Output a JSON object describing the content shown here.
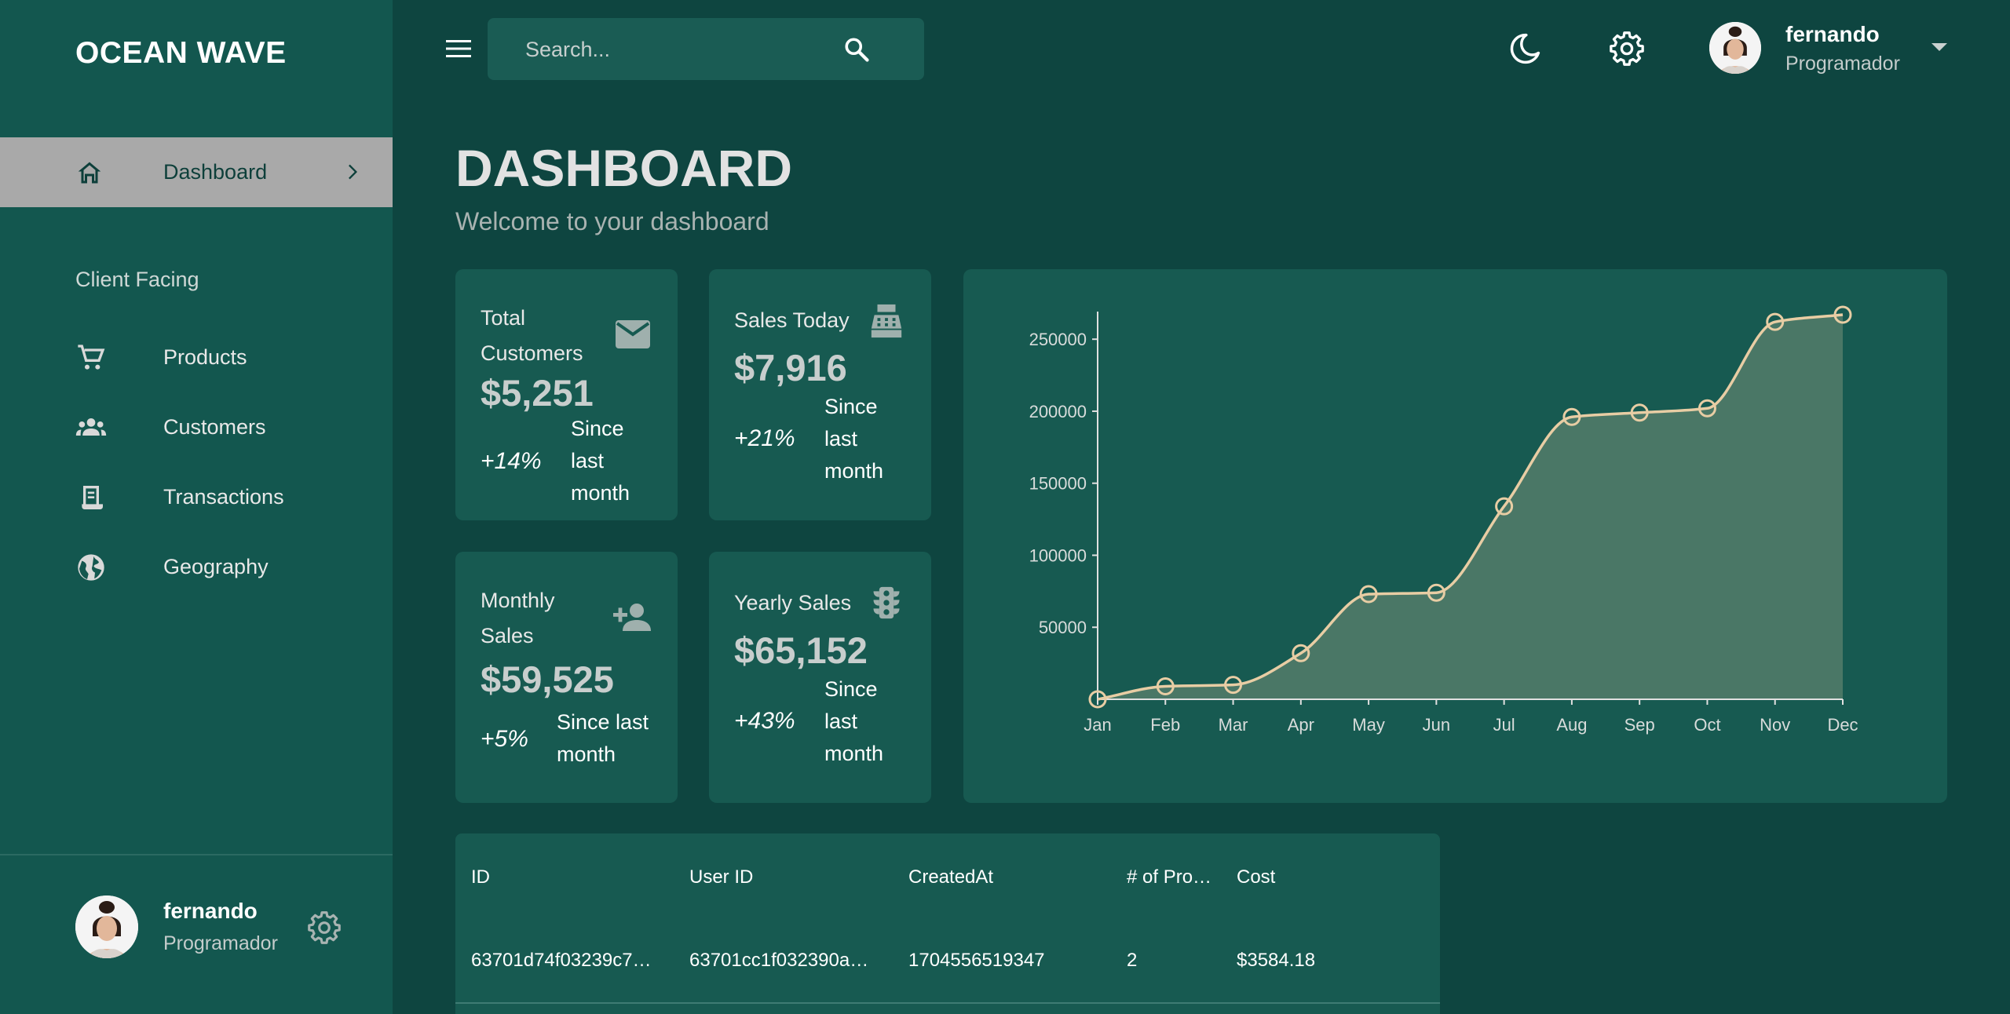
{
  "brand": "OCEAN WAVE",
  "sidebar": {
    "active": {
      "label": "Dashboard",
      "icon": "home-icon"
    },
    "section_title": "Client Facing",
    "items": [
      {
        "label": "Products",
        "icon": "shopping-cart-icon"
      },
      {
        "label": "Customers",
        "icon": "groups-icon"
      },
      {
        "label": "Transactions",
        "icon": "receipt-icon"
      },
      {
        "label": "Geography",
        "icon": "globe-icon"
      }
    ],
    "footer": {
      "name": "fernando",
      "role": "Programador"
    }
  },
  "topbar": {
    "search_placeholder": "Search...",
    "user": {
      "name": "fernando",
      "role": "Programador"
    }
  },
  "header": {
    "title": "DASHBOARD",
    "subtitle": "Welcome to your dashboard"
  },
  "stats": [
    {
      "title_lines": [
        "Total",
        "Customers"
      ],
      "value": "$5,251",
      "pct": "+14%",
      "note_lines": [
        "Since",
        "last",
        "month"
      ],
      "icon": "email-icon"
    },
    {
      "title_lines": [
        "Sales Today"
      ],
      "value": "$7,916",
      "pct": "+21%",
      "note_lines": [
        "Since",
        "last",
        "month"
      ],
      "icon": "point-of-sale-icon"
    },
    {
      "title_lines": [
        "Monthly",
        "Sales"
      ],
      "value": "$59,525",
      "pct": "+5%",
      "note_lines": [
        "Since last",
        "month"
      ],
      "icon": "person-add-icon"
    },
    {
      "title_lines": [
        "Yearly Sales"
      ],
      "value": "$65,152",
      "pct": "+43%",
      "note_lines": [
        "Since",
        "last",
        "month"
      ],
      "icon": "traffic-icon"
    }
  ],
  "chart_data": {
    "type": "area",
    "categories": [
      "Jan",
      "Feb",
      "Mar",
      "Apr",
      "May",
      "Jun",
      "Jul",
      "Aug",
      "Sep",
      "Oct",
      "Nov",
      "Dec"
    ],
    "series": [
      {
        "values": [
          0,
          9000,
          10000,
          32000,
          73000,
          74000,
          134000,
          196000,
          199000,
          202000,
          262000,
          267000
        ]
      }
    ],
    "yticks": [
      50000,
      100000,
      150000,
      200000,
      250000
    ],
    "ylim": [
      0,
      267000
    ],
    "grid": false,
    "colors": {
      "line": "#e8cda4",
      "fill": "#4a7766"
    }
  },
  "table": {
    "columns": [
      "ID",
      "User ID",
      "CreatedAt",
      "# of Pro…",
      "Cost"
    ],
    "rows": [
      [
        "63701d74f03239c7…",
        "63701cc1f032390a…",
        "1704556519347",
        "2",
        "$3584.18"
      ]
    ]
  },
  "colors": {
    "background": "#0e4540",
    "sidebar": "#13574f",
    "card": "#175a51",
    "active_nav": "#a9a9a9"
  }
}
